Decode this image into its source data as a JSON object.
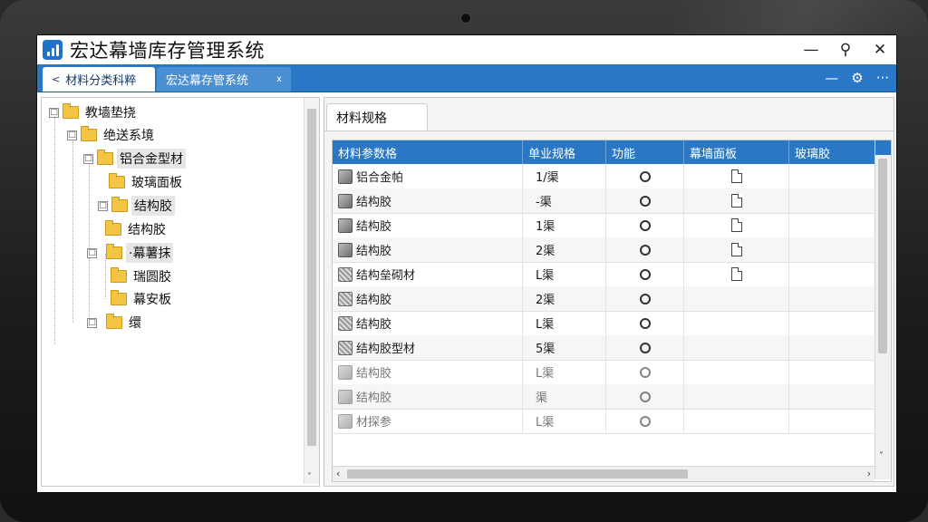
{
  "window": {
    "title": "宏达幕墙库存管理系统",
    "controls": {
      "minimize": "—",
      "search": "⚲",
      "close": "✕"
    }
  },
  "tabs": [
    {
      "label": "材料分类科粹",
      "chevron": "<"
    },
    {
      "label": "宏达幕存管系统",
      "pin": "ⅹ"
    }
  ],
  "toolbar": {
    "minus": "—",
    "gear": "⚙",
    "more": "···"
  },
  "tree": [
    {
      "label": "教墙垫挠",
      "toggle": "□"
    },
    {
      "label": "绝送系境",
      "toggle": "□"
    },
    {
      "label": "铝合金型材",
      "toggle": "□"
    },
    {
      "label": "玻璃面板",
      "toggle": ""
    },
    {
      "label": "结构胶",
      "toggle": "□"
    },
    {
      "label": "结构胶",
      "toggle": ""
    },
    {
      "label": "·幕薯抹",
      "toggle": "□"
    },
    {
      "label": "瑞圆胶",
      "toggle": ""
    },
    {
      "label": "幕安板",
      "toggle": ""
    },
    {
      "label": "缳",
      "toggle": "□"
    }
  ],
  "panel_tab": {
    "label": "材料规格"
  },
  "grid": {
    "columns": [
      "材料参数格",
      "单业规格",
      "功能",
      "幕墙面板",
      "玻璃胶"
    ],
    "rows": [
      {
        "icon": "pencil",
        "name": "铝合金帕",
        "spec": "1/渠",
        "doc": true,
        "fade": false
      },
      {
        "icon": "pencil",
        "name": "结构胶",
        "spec": "-渠",
        "doc": true,
        "fade": false
      },
      {
        "icon": "pencil",
        "name": "结构胶",
        "spec": "1渠",
        "doc": true,
        "fade": false
      },
      {
        "icon": "pencil",
        "name": "结构胶",
        "spec": "2渠",
        "doc": true,
        "fade": false
      },
      {
        "icon": "cube",
        "name": "结构垒砌材",
        "spec": "L渠",
        "doc": true,
        "fade": false
      },
      {
        "icon": "cube",
        "name": "结构胶",
        "spec": "2渠",
        "doc": false,
        "fade": false
      },
      {
        "icon": "cube",
        "name": "结构胶",
        "spec": "L渠",
        "doc": false,
        "fade": false
      },
      {
        "icon": "cube",
        "name": "结构胶型材",
        "spec": "5渠",
        "doc": false,
        "fade": false
      },
      {
        "icon": "pencil",
        "name": "结构胶",
        "spec": "L渠",
        "doc": false,
        "fade": true
      },
      {
        "icon": "pencil",
        "name": "结构胶",
        "spec": "渠",
        "doc": false,
        "fade": true
      },
      {
        "icon": "pencil",
        "name": "材探参",
        "spec": "L渠",
        "doc": false,
        "fade": true
      }
    ]
  },
  "scroll": {
    "down": "˅",
    "left": "‹",
    "right": "›"
  }
}
